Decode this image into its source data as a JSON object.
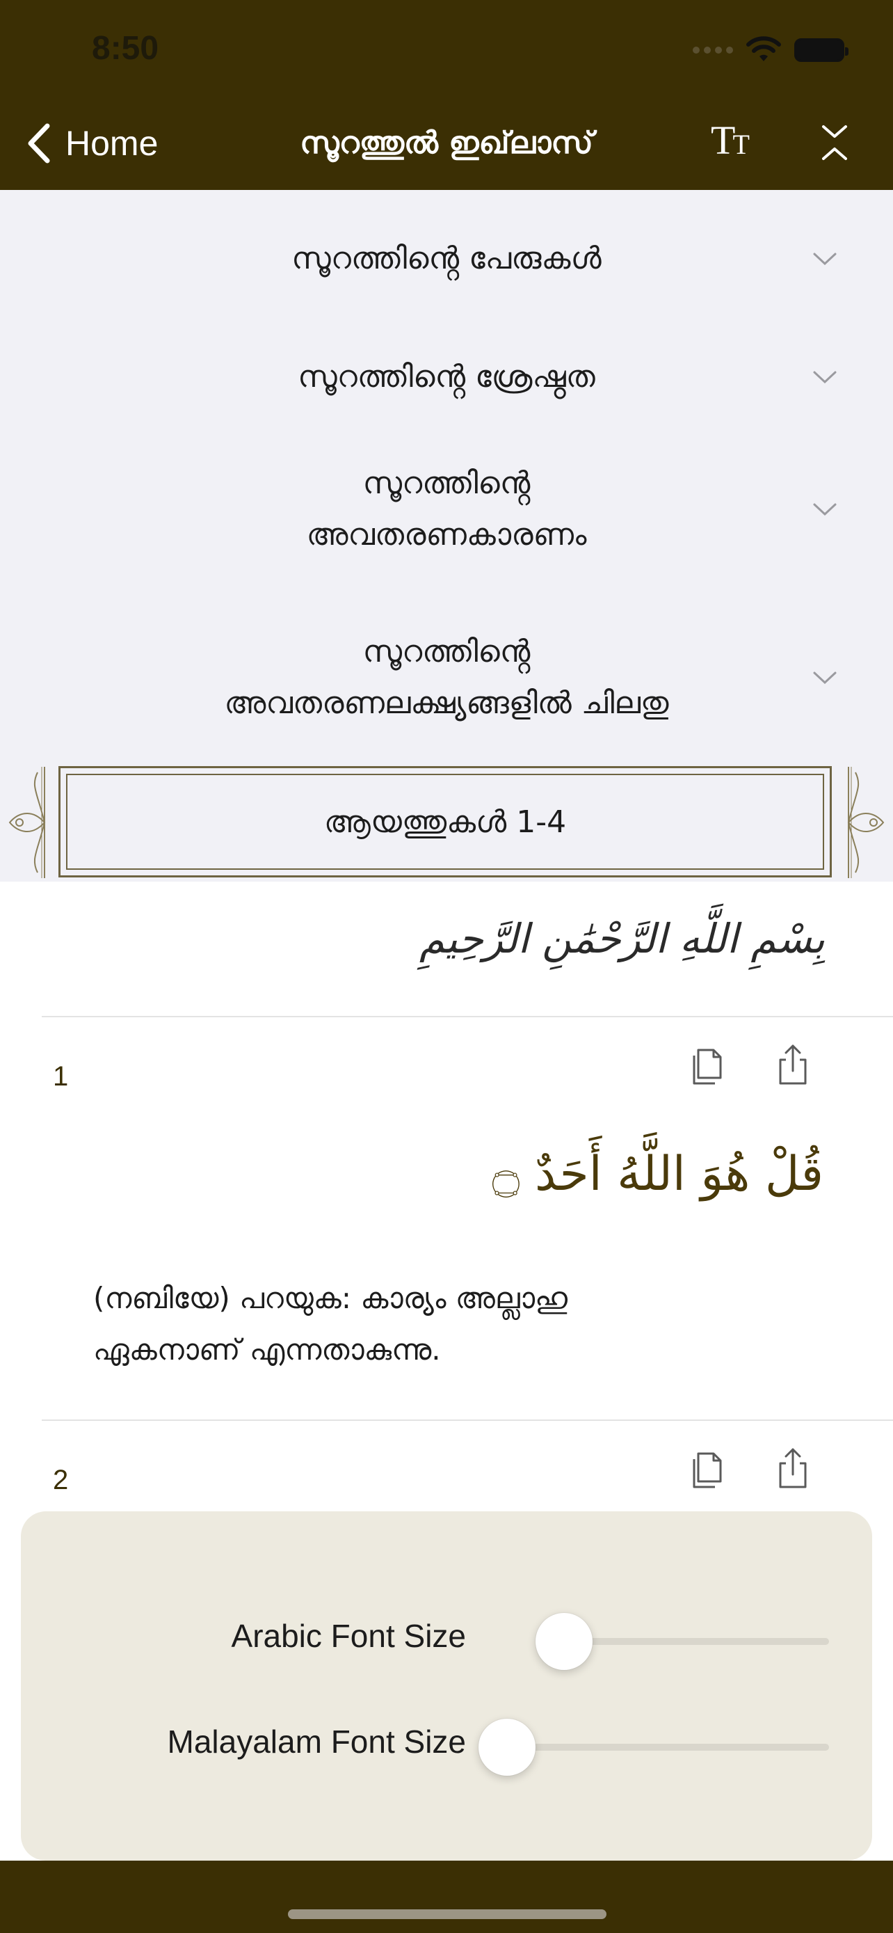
{
  "status_bar": {
    "time": "8:50"
  },
  "nav": {
    "back_label": "Home",
    "title": "സൂറത്തുൽ ഇഖ്‌ലാസ്",
    "font_icon": "TT"
  },
  "sections": [
    {
      "label": "സൂറത്തിൻ്റെ പേരുകൾ"
    },
    {
      "label": "സൂറത്തിൻ്റെ ശ്രേഷ്ഠത"
    },
    {
      "label_line1": "സൂറത്തിൻ്റെ",
      "label_line2": "അവതരണകാരണം"
    },
    {
      "label_line1": "സൂറത്തിൻ്റെ",
      "label_line2": "അവതരണലക്ഷ്യങ്ങളിൽ ചിലതു"
    }
  ],
  "ayah_group": {
    "label": "ആയത്തുകൾ 1-4"
  },
  "bismillah": "بِسْمِ اللَّهِ الرَّحْمَٰنِ الرَّحِيمِ",
  "ayahs": [
    {
      "number": "1",
      "arabic": "قُلْ هُوَ اللَّهُ أَحَدٌ ۝",
      "translation_line1": "(നബിയേ) പറയുക: കാര്യം അല്ലാഹു",
      "translation_line2": "ഏകനാണ് എന്നതാകുന്നു."
    },
    {
      "number": "2"
    }
  ],
  "font_panel": {
    "arabic_label": "Arabic Font Size",
    "malayalam_label": "Malayalam Font Size",
    "arabic_value": 0,
    "malayalam_value": 0
  },
  "colors": {
    "brand": "#3b2f04",
    "panel": "#edeadf",
    "sections_bg": "#f1f1f6"
  },
  "icons": [
    "chevron-left-icon",
    "text-size-icon",
    "collapse-icon",
    "chevron-down-icon",
    "copy-icon",
    "share-icon",
    "ornament-icon",
    "wifi-icon",
    "battery-icon"
  ]
}
